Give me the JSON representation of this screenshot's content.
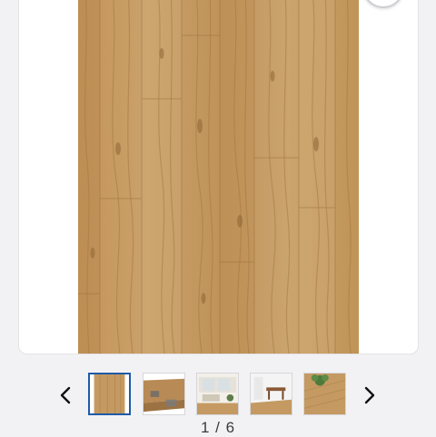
{
  "gallery": {
    "icons": {
      "zoom": "magnify-icon",
      "prev": "chevron-left-icon",
      "next": "chevron-right-icon"
    },
    "thumbnails": [
      {
        "name": "oak-plank-swatch",
        "selected": true
      },
      {
        "name": "flooring-planks-closeup",
        "selected": false
      },
      {
        "name": "living-room-interior",
        "selected": false
      },
      {
        "name": "dining-room-interior",
        "selected": false
      },
      {
        "name": "floor-with-plant",
        "selected": false
      }
    ],
    "pager": {
      "current": "1",
      "separator": " / ",
      "total": "6"
    }
  },
  "colors": {
    "wood_base": "#c49a62",
    "wood_dark": "#a77c47",
    "wood_light": "#d8b47f",
    "selected_border": "#1f5aa8"
  }
}
